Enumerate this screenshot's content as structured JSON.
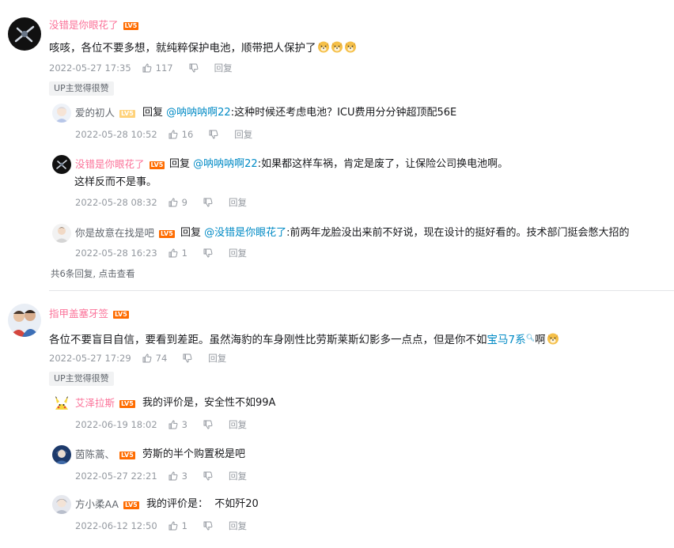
{
  "threads": [
    {
      "author": "没错是你眼花了",
      "level": "LV5",
      "text": "咳咳，各位不要多想，就纯粹保护电池，顺带把人保护了",
      "time": "2022-05-27 17:35",
      "likes": "117",
      "reply_label": "回复",
      "up_tag": "UP主觉得很赞",
      "replies": [
        {
          "author": "爱的初人",
          "level": "LV5",
          "reply_prefix": "回复",
          "at": "@呐呐呐啊22",
          "text": ":这种时候还考虑电池？ICU费用分分钟超顶配56E",
          "time": "2022-05-28 10:52",
          "likes": "16",
          "reply_label": "回复"
        },
        {
          "author": "没错是你眼花了",
          "level": "LV5",
          "reply_prefix": "回复",
          "at": "@呐呐呐啊22",
          "text": ":如果都这样车祸，肯定是废了，让保险公司换电池啊。",
          "text2": "这样反而不是事。",
          "time": "2022-05-28 08:32",
          "likes": "9",
          "reply_label": "回复"
        },
        {
          "author": "你是故意在找是吧",
          "level": "LV5",
          "reply_prefix": "回复",
          "at": "@没错是你眼花了",
          "text": ":前两年龙脸没出来前不好说，现在设计的挺好看的。技术部门挺会憋大招的",
          "time": "2022-05-28 16:23",
          "likes": "1",
          "reply_label": "回复"
        }
      ],
      "more_text": "共6条回复, 点击查看"
    },
    {
      "author": "指甲盖塞牙签",
      "level": "LV5",
      "text_before": "各位不要盲目自信，要看到差距。虽然海豹的车身刚性比劳斯莱斯幻影多一点点，但是你不如",
      "link": "宝马7系",
      "text_after": "啊",
      "time": "2022-05-27 17:29",
      "likes": "74",
      "reply_label": "回复",
      "up_tag": "UP主觉得很赞",
      "replies": [
        {
          "author": "艾泽拉斯",
          "level": "LV5",
          "text": "我的评价是，安全性不如99A",
          "time": "2022-06-19 18:02",
          "likes": "3",
          "reply_label": "回复"
        },
        {
          "author": "茵陈蒿、",
          "level": "LV5",
          "text": "劳斯的半个购置税是吧",
          "time": "2022-05-27 22:21",
          "likes": "3",
          "reply_label": "回复"
        },
        {
          "author": "方小柔AA",
          "level": "LV5",
          "text": "我的评价是：  不如歼20",
          "time": "2022-06-12 12:50",
          "likes": "1",
          "reply_label": "回复"
        }
      ]
    }
  ],
  "icons": {
    "like": "thumbs-up-icon",
    "dislike": "thumbs-down-icon",
    "search": "search-icon",
    "emoji": "doge-emoji"
  },
  "colors": {
    "username_pink": "#fb7299",
    "link_blue": "#008ac5",
    "meta_gray": "#9499a0",
    "level_orange": "#ff6c00"
  }
}
